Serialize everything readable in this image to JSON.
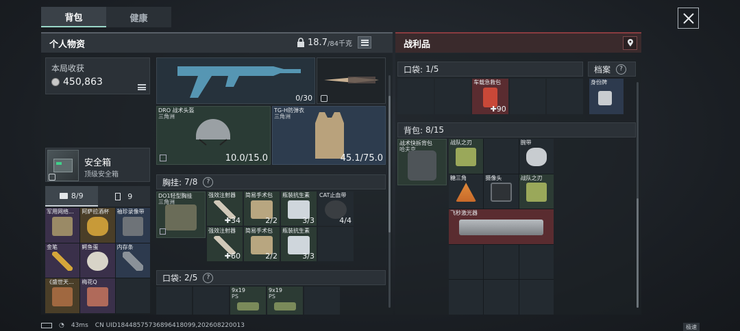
{
  "tabs": [
    {
      "label": "背包"
    },
    {
      "label": "健康"
    }
  ],
  "left_panel": {
    "title": "个人物资",
    "capacity": "18.7",
    "capacity_max": "/84千克"
  },
  "right_panel": {
    "title": "战利品"
  },
  "stats": {
    "label": "本局收获",
    "value": "450,863"
  },
  "safe_box": {
    "name": "安全箱",
    "sub": "顶级安全箱"
  },
  "sub_tabs": [
    {
      "label": "8/9"
    },
    {
      "label": "9"
    }
  ],
  "stash_items": [
    {
      "name": "军用网络...",
      "color": "purple"
    },
    {
      "name": "阿萨拉酒杯",
      "color": "gold"
    },
    {
      "name": "袖珍录像带",
      "color": "blue"
    },
    {
      "name": "金笔",
      "color": "purple"
    },
    {
      "name": "鳄鱼蛋",
      "color": "purple"
    },
    {
      "name": "内存条",
      "color": "blue"
    },
    {
      "name": "《盛世天...",
      "color": "gold"
    },
    {
      "name": "梅花Q",
      "color": "purple"
    },
    {
      "name": "",
      "color": ""
    }
  ],
  "weapon": {
    "ammo": "0/30"
  },
  "helmet": {
    "name": "DRO 战术头盔",
    "origin": "三角洲",
    "durability": "10.0/15.0"
  },
  "armor": {
    "name": "TG-H防弹衣",
    "origin": "三角洲",
    "durability": "45.1/75.0"
  },
  "chest_rig": {
    "label": "胸挂:",
    "count": "7/8",
    "rig_name": "DO1轻型胸挂",
    "rig_origin": "三角洲",
    "items": [
      {
        "name": "强效注射器",
        "count": "34"
      },
      {
        "name": "简易手术包",
        "count": "2/2"
      },
      {
        "name": "瓶装抗生素",
        "count": "3/3"
      },
      {
        "name": "CAT止血带",
        "count": "4/4"
      },
      {
        "name": "强效注射器",
        "count": "60"
      },
      {
        "name": "简易手术包",
        "count": "2/2"
      },
      {
        "name": "瓶装抗生素",
        "count": "3/3"
      }
    ]
  },
  "pocket_left": {
    "label": "口袋:",
    "count": "2/5",
    "items": [
      {
        "name": "9x19",
        "sub": "PS"
      },
      {
        "name": "9x19",
        "sub": "PS"
      }
    ]
  },
  "loot_pocket": {
    "label": "口袋:",
    "count": "1/5",
    "item": "车载急救包",
    "item_count": "90"
  },
  "archive": {
    "label": "档案",
    "item": "身份牌"
  },
  "loot_bag": {
    "label": "背包:",
    "count": "8/15",
    "bag_name": "战术快拆背包",
    "bag_origin": "哈夫克",
    "items": [
      {
        "name": "战队之刃"
      },
      {
        "name": "腕带"
      },
      {
        "name": "糖三角"
      },
      {
        "name": "摄像头"
      },
      {
        "name": "战队之刃"
      },
      {
        "name": "飞秒激光器"
      }
    ]
  },
  "status_bar": {
    "ping": "43ms",
    "uid": "CN UID18448575736896418099,202608220013",
    "speed": "极速"
  },
  "colors": {
    "accent": "#9ad7c8",
    "loot": "#8a3c40",
    "purple": "#3a304a",
    "gold": "#4a3e28",
    "blue": "#2d3a4e",
    "red": "#5a2c30"
  }
}
